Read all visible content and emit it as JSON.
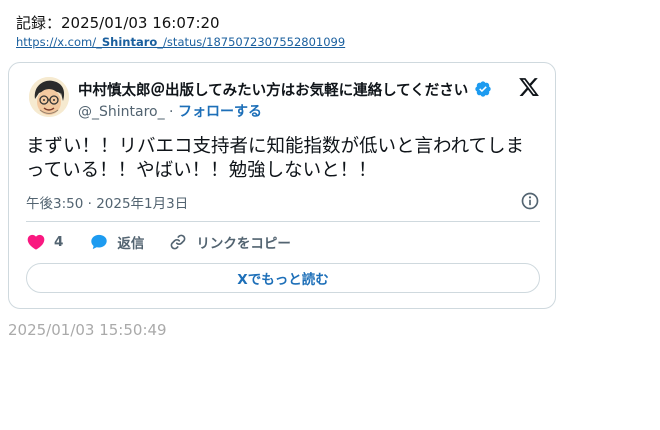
{
  "record": {
    "label": "記録：2025/01/03 16:07:20",
    "link_prefix": "https://x.com/",
    "link_user": "_Shintaro_",
    "link_suffix": "/status/1875072307552801099"
  },
  "tweet": {
    "display_name": "中村慎太郎＠出版してみたい方はお気軽に連絡してください",
    "handle": "@_Shintaro_",
    "separator": " · ",
    "follow_label": "フォローする",
    "text": "まずい！！リバエコ支持者に知能指数が低いと言われてしまっている！！やばい！！勉強しないと！！",
    "time": "午後3:50",
    "date": "2025年1月3日",
    "meta_separator": " · ",
    "likes": "4",
    "reply_label": "返信",
    "copy_link_label": "リンクをコピー",
    "read_more_label": "Xでもっと読む"
  },
  "footer": {
    "timestamp": "2025/01/03 15:50:49"
  },
  "colors": {
    "like": "#f91880",
    "reply": "#1d9bf0",
    "link": "#1d6fb8",
    "verified": "#1d9bf0"
  }
}
